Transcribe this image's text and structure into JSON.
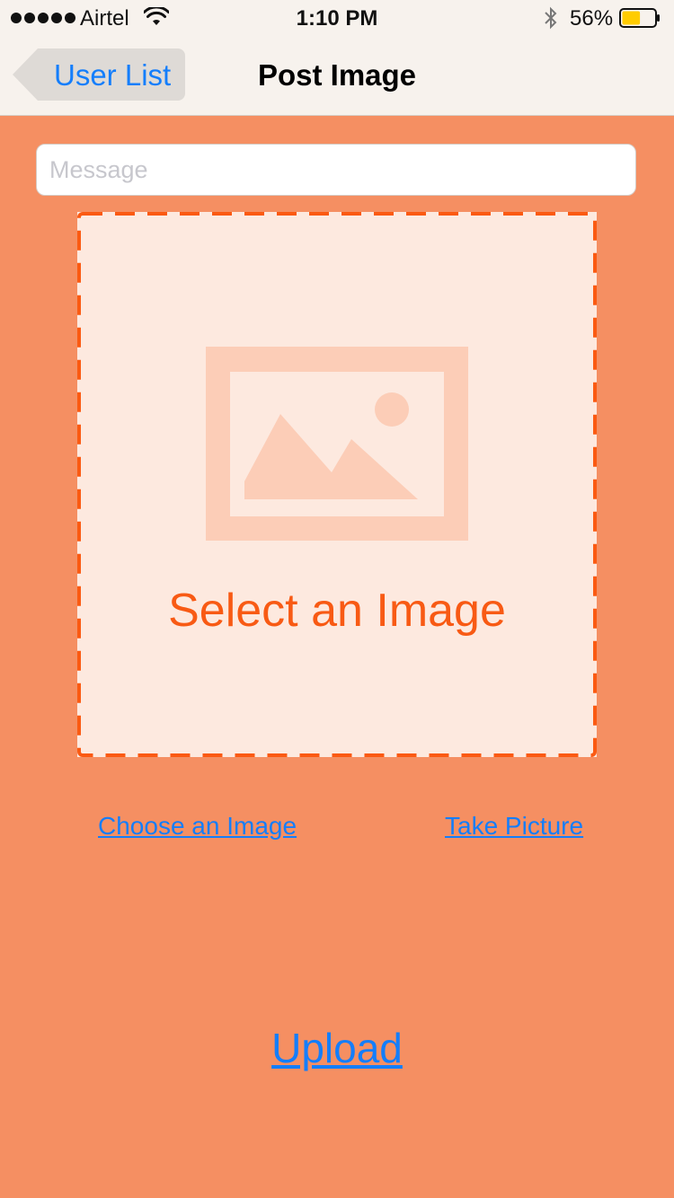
{
  "status_bar": {
    "carrier": "Airtel",
    "time": "1:10 PM",
    "battery_percent": "56%",
    "battery_level": 0.56,
    "signal_bars": 5
  },
  "nav": {
    "back_label": "User List",
    "title": "Post Image"
  },
  "message": {
    "placeholder": "Message",
    "value": ""
  },
  "image_picker": {
    "label": "Select an Image",
    "icon": "image-placeholder-icon"
  },
  "actions": {
    "choose_image": "Choose an Image",
    "take_picture": "Take Picture",
    "upload": "Upload"
  },
  "colors": {
    "background": "#f58f62",
    "accent_orange": "#f85a14",
    "link_blue": "#147efb",
    "bar_background": "#f7f2ed"
  }
}
